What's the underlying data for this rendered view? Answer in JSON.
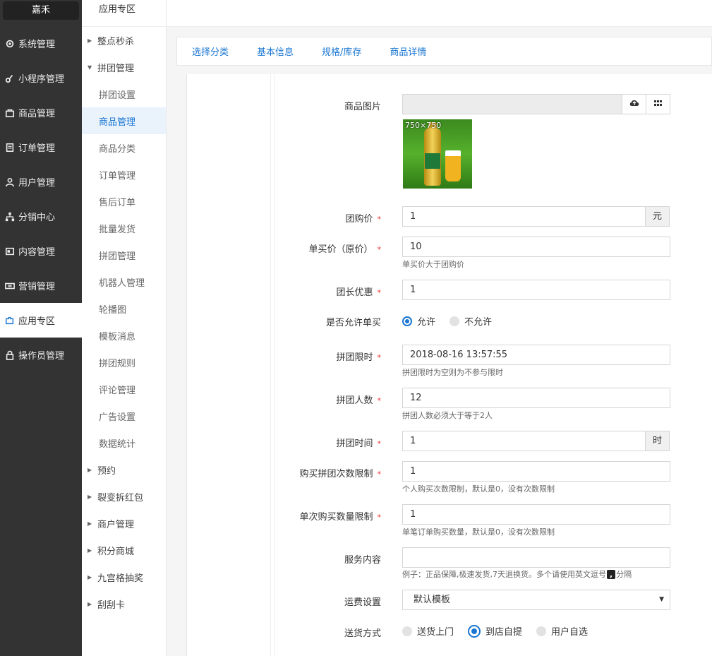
{
  "brand": "嘉禾",
  "sidebar": {
    "items": [
      {
        "label": "系统管理",
        "icon": "gear-icon"
      },
      {
        "label": "小程序管理",
        "icon": "link-icon"
      },
      {
        "label": "商品管理",
        "icon": "bag-icon"
      },
      {
        "label": "订单管理",
        "icon": "clipboard-icon"
      },
      {
        "label": "用户管理",
        "icon": "user-icon"
      },
      {
        "label": "分销中心",
        "icon": "sitemap-icon"
      },
      {
        "label": "内容管理",
        "icon": "content-icon"
      },
      {
        "label": "营销管理",
        "icon": "ticket-icon"
      },
      {
        "label": "应用专区",
        "icon": "puzzle-icon"
      },
      {
        "label": "操作员管理",
        "icon": "lock-icon"
      }
    ]
  },
  "subnav": {
    "title": "应用专区",
    "items": [
      "整点秒杀",
      "拼团管理",
      "拼团设置",
      "商品管理",
      "商品分类",
      "订单管理",
      "售后订单",
      "批量发货",
      "拼团管理",
      "机器人管理",
      "轮播图",
      "模板消息",
      "拼团规则",
      "评论管理",
      "广告设置",
      "数据统计",
      "预约",
      "裂变拆红包",
      "商户管理",
      "积分商城",
      "九宫格抽奖",
      "刮刮卡"
    ]
  },
  "tabs": [
    "选择分类",
    "基本信息",
    "规格/库存",
    "商品详情"
  ],
  "form": {
    "image_label": "商品图片",
    "thumb_size": "750×750",
    "group_price_label": "团购价",
    "group_price": "1",
    "yuan": "元",
    "single_price_label": "单买价（原价）",
    "single_price": "10",
    "single_price_hint": "单买价大于团购价",
    "leader_discount_label": "团长优惠",
    "leader_discount": "1",
    "allow_single_label": "是否允许单买",
    "allow": "允许",
    "disallow": "不允许",
    "time_limit_label": "拼团限时",
    "time_limit": "2018-08-16 13:57:55",
    "time_limit_hint": "拼团限时为空则为不参与限时",
    "group_size_label": "拼团人数",
    "group_size": "12",
    "group_size_hint": "拼团人数必须大于等于2人",
    "group_time_label": "拼团时间",
    "group_time": "1",
    "hour": "时",
    "buy_times_label": "购买拼团次数限制",
    "buy_times": "1",
    "buy_times_hint": "个人购买次数限制，默认是0，没有次数限制",
    "single_qty_label": "单次购买数量限制",
    "single_qty": "1",
    "single_qty_hint": "单笔订单购买数量，默认是0，没有次数限制",
    "service_label": "服务内容",
    "service": "",
    "service_hint_a": "例子：正品保障,极速发货,7天退换货。多个请使用英文逗号",
    "service_hint_comma": ",",
    "service_hint_b": "分隔",
    "shipping_label": "运费设置",
    "shipping_value": "默认模板",
    "delivery_label": "送货方式",
    "delivery_options": [
      "送货上门",
      "到店自提",
      "用户自选"
    ],
    "required_mark": "*"
  }
}
